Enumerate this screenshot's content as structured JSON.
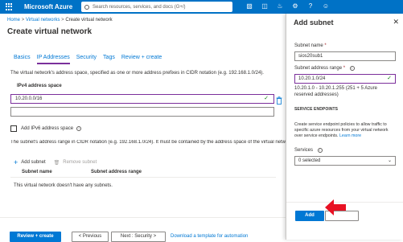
{
  "topbar": {
    "brand": "Microsoft Azure",
    "search_placeholder": "Search resources, services, and docs (G+/)"
  },
  "breadcrumb": {
    "items": [
      "Home",
      "Virtual networks",
      "Create virtual network"
    ],
    "separator": ">"
  },
  "page": {
    "title": "Create virtual network",
    "tabs": [
      "Basics",
      "IP Addresses",
      "Security",
      "Tags",
      "Review + create"
    ],
    "active_tab": "IP Addresses",
    "description": "The virtual network's address space, specified as one or more address prefixes in CIDR notation (e.g. 192.168.1.0/24).",
    "ipv4_label": "IPv4 address space",
    "ipv4_value": "10.20.0.0/16",
    "ipv4_empty_value": "",
    "ipv6_label": "Add IPv6 address space",
    "subnet_description": "The subnet's address range in CIDR notation (e.g. 192.168.1.0/24). It must be contained by the address space of the virtual network.",
    "add_subnet": "Add subnet",
    "remove_subnet": "Remove subnet",
    "columns": [
      "Subnet name",
      "Subnet address range"
    ],
    "empty_text": "This virtual network doesn't have any subnets."
  },
  "footer": {
    "review_create": "Review + create",
    "previous": "< Previous",
    "next": "Next : Security >",
    "download": "Download a template for automation"
  },
  "panel": {
    "title": "Add subnet",
    "subnet_name_label": "Subnet name",
    "subnet_name_value": "sios20sub1",
    "address_range_label": "Subnet address range",
    "address_range_value": "10.20.1.0/24",
    "address_range_hint": "10.20.1.0 - 10.20.1.255 (251 + 5 Azure reserved addresses)",
    "service_endpoints_heading": "SERVICE ENDPOINTS",
    "service_endpoints_text": "Create service endpoint policies to allow traffic to specific azure resources from your virtual network over service endpoints.",
    "learn_more": "Learn more",
    "services_label": "Services",
    "services_value": "0 selected",
    "add_button": "Add",
    "required_marker": "*"
  },
  "colors": {
    "azure_blue": "#0072c6",
    "primary": "#0078d4",
    "focus": "#7b2f9b",
    "arrow": "#e81123"
  },
  "icons": [
    "waffle-icon",
    "search-icon",
    "cloud-shell-icon",
    "directory-filter-icon",
    "notifications-icon",
    "settings-icon",
    "help-icon",
    "feedback-icon",
    "check-icon",
    "trash-icon",
    "info-icon",
    "plus-icon",
    "chevron-down-icon",
    "close-icon",
    "red-arrow-annotation"
  ]
}
